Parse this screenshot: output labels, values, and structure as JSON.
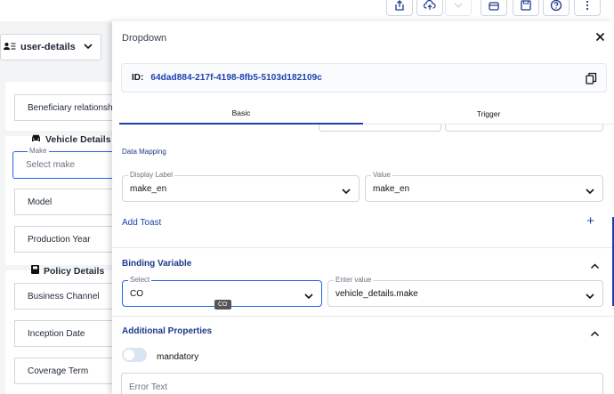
{
  "toolbar": {
    "buttons": [
      "share-icon",
      "cloud-upload-icon",
      "chevron-down-icon",
      "panel-icon",
      "save-icon",
      "help-icon",
      "more-icon"
    ]
  },
  "left": {
    "user_select": "user-details",
    "beneficiary": "Beneficiary relationship",
    "vehicle_title": "Vehicle Details",
    "make_label": "Make",
    "make_placeholder": "Select make",
    "model": "Model",
    "production_year": "Production Year",
    "policy_title": "Policy Details",
    "business_channel": "Business Channel",
    "inception_date": "Inception Date",
    "coverage_term": "Coverage Term"
  },
  "panel": {
    "title": "Dropdown",
    "id_label": "ID:",
    "id_value": "64dad884-217f-4198-8fb5-5103d182109c",
    "tabs": [
      "Basic",
      "Trigger"
    ],
    "data_mapping": "Data Mapping",
    "display_label_title": "Display Label",
    "display_label_value": "make_en",
    "value_title": "Value",
    "value_value": "make_en",
    "add_toast": "Add Toast",
    "binding_variable": "Binding Variable",
    "select_title": "Select",
    "select_value": "CO",
    "tooltip": "CO",
    "enter_value_title": "Enter value",
    "enter_value_value": "vehicle_details.make",
    "additional_properties": "Additional Properties",
    "mandatory": "mandatory",
    "error_text_placeholder": "Error Text"
  }
}
